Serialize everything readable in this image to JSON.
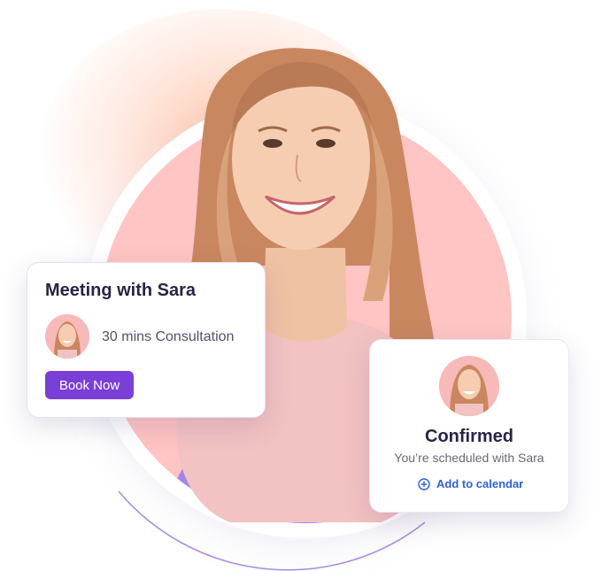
{
  "meeting_card": {
    "title": "Meeting with Sara",
    "consultation": "30 mins Consultation",
    "book_button": "Book Now"
  },
  "confirm_card": {
    "status": "Confirmed",
    "subtitle": "You’re scheduled with Sara",
    "add_calendar": "Add to calendar"
  },
  "colors": {
    "accent_purple": "#7a3fd6",
    "pink_circle": "#ffc4c4",
    "link_blue": "#2f5fe0"
  },
  "icons": [
    "plus-circle-icon"
  ]
}
